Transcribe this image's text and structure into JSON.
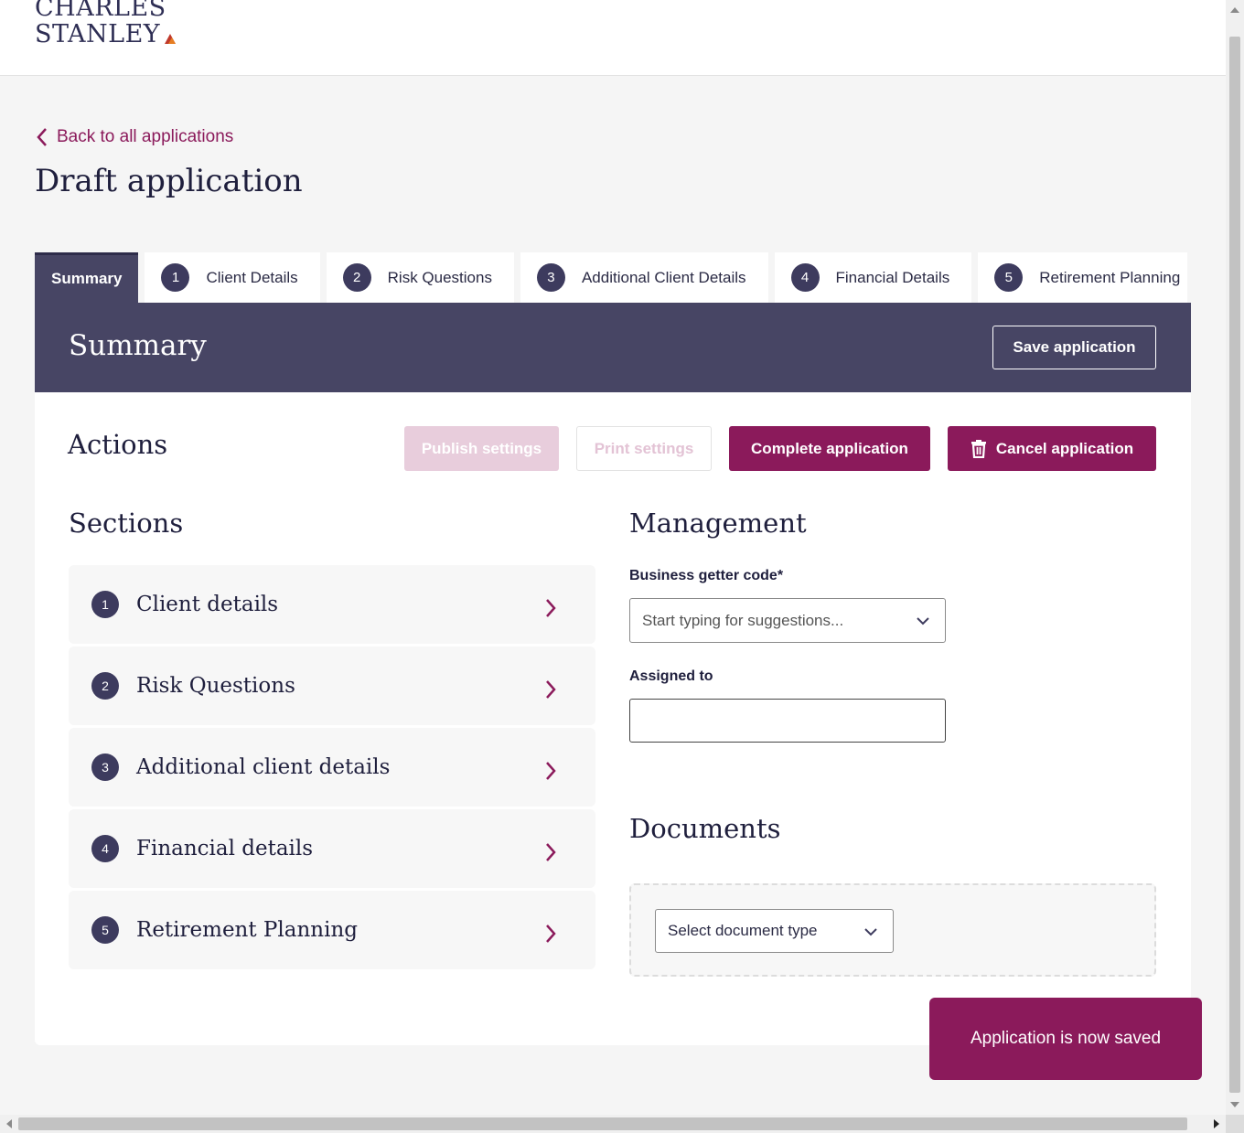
{
  "brand": {
    "line1": "CHARLES",
    "line2": "STANLEY"
  },
  "nav": {
    "back_label": "Back to all applications"
  },
  "page": {
    "title": "Draft application"
  },
  "tabs": [
    {
      "label": "Summary",
      "number": ""
    },
    {
      "label": "Client Details",
      "number": "1"
    },
    {
      "label": "Risk Questions",
      "number": "2"
    },
    {
      "label": "Additional Client Details",
      "number": "3"
    },
    {
      "label": "Financial Details",
      "number": "4"
    },
    {
      "label": "Retirement Planning",
      "number": "5"
    }
  ],
  "panel": {
    "title": "Summary",
    "save_label": "Save application"
  },
  "actions": {
    "title": "Actions",
    "publish_label": "Publish settings",
    "print_label": "Print settings",
    "complete_label": "Complete application",
    "cancel_label": "Cancel application"
  },
  "sections": {
    "title": "Sections",
    "items": [
      {
        "number": "1",
        "label": "Client details"
      },
      {
        "number": "2",
        "label": "Risk Questions"
      },
      {
        "number": "3",
        "label": "Additional client details"
      },
      {
        "number": "4",
        "label": "Financial details"
      },
      {
        "number": "5",
        "label": "Retirement Planning"
      }
    ]
  },
  "management": {
    "title": "Management",
    "business_getter_label": "Business getter code*",
    "business_getter_placeholder": "Start typing for suggestions...",
    "assigned_label": "Assigned to",
    "assigned_value": ""
  },
  "documents": {
    "title": "Documents",
    "select_placeholder": "Select document type"
  },
  "toast": {
    "message": "Application is now saved"
  },
  "colors": {
    "accent": "#8b1a5b",
    "header": "#474564",
    "badge": "#3d3b5e"
  },
  "icons": {
    "back": "chevron-left-icon",
    "section": "chevron-right-icon",
    "dropdown": "chevron-down-icon",
    "cancel": "trash-icon"
  }
}
